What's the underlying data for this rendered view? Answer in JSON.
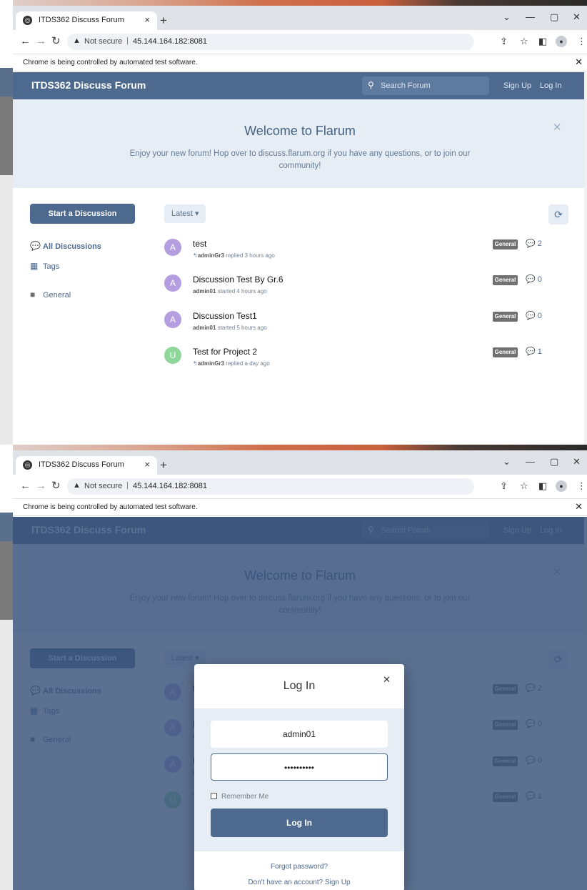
{
  "browser": {
    "tab_title": "ITDS362 Discuss Forum",
    "tab_close": "×",
    "new_tab": "+",
    "not_secure": "Not secure",
    "url": "45.144.164.182:8081",
    "infobar": "Chrome is being controlled by automated test software."
  },
  "forum": {
    "brand": "ITDS362 Discuss Forum",
    "search_placeholder": "Search Forum",
    "signup": "Sign Up",
    "login": "Log In",
    "hero_title": "Welcome to Flarum",
    "hero_text": "Enjoy your new forum! Hop over to discuss.flarum.org if you have any questions, or to join our community!",
    "start_button": "Start a Discussion",
    "sort_label": "Latest",
    "nav": [
      {
        "label": "All Discussions",
        "icon": "discussions-icon"
      },
      {
        "label": "Tags",
        "icon": "tags-icon"
      },
      {
        "label": "General",
        "icon": "tag-square-icon"
      }
    ],
    "discussions": [
      {
        "avatar": "A",
        "avatar_color": "#b49ee0",
        "title": "test",
        "user": "adminGr3",
        "action": "replied 3 hours ago",
        "reply_icon": true,
        "tag": "General",
        "count": "2"
      },
      {
        "avatar": "A",
        "avatar_color": "#b49ee0",
        "title": "Discussion Test By Gr.6",
        "user": "admin01",
        "action": "started 4 hours ago",
        "reply_icon": false,
        "tag": "General",
        "count": "0"
      },
      {
        "avatar": "A",
        "avatar_color": "#b49ee0",
        "title": "Discussion Test1",
        "user": "admin01",
        "action": "started 5 hours ago",
        "reply_icon": false,
        "tag": "General",
        "count": "0"
      },
      {
        "avatar": "U",
        "avatar_color": "#8fd69a",
        "title": "Test for Project 2",
        "user": "adminGr3",
        "action": "replied a day ago",
        "reply_icon": true,
        "tag": "General",
        "count": "1"
      }
    ]
  },
  "login_modal": {
    "title": "Log In",
    "username_value": "admin01",
    "password_value": "••••••••••",
    "remember_me": "Remember Me",
    "submit": "Log In",
    "forgot": "Forgot password?",
    "signup_prompt": "Don't have an account? Sign Up"
  },
  "colors": {
    "header": "#4d698e",
    "hero_bg": "#e7edf4",
    "overlay": "#38527a"
  }
}
